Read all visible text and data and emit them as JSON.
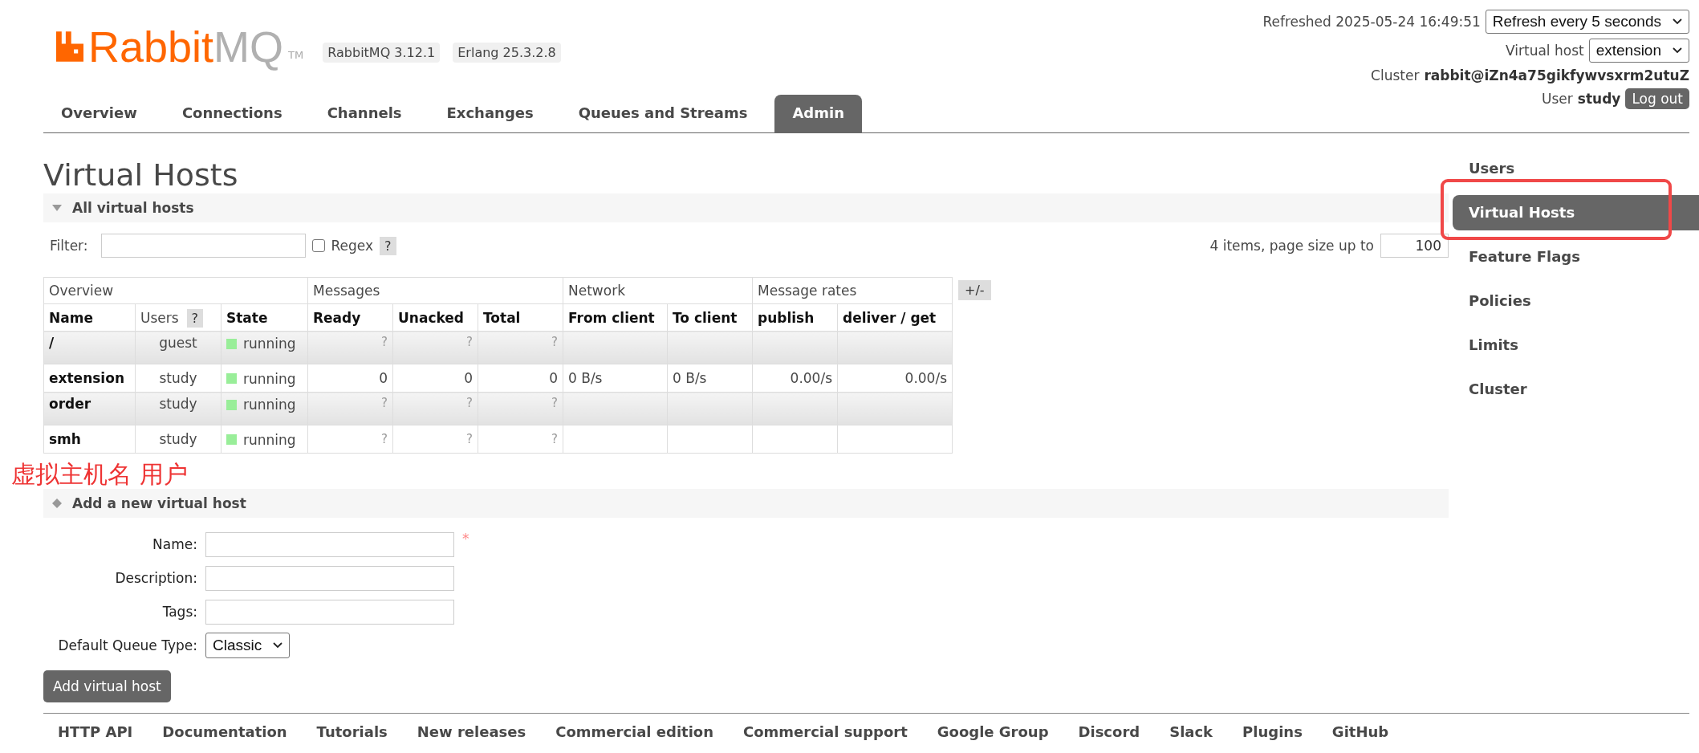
{
  "logo": {
    "brand": "Rabbit",
    "brand_suffix": "MQ",
    "trademark": "TM"
  },
  "version_badges": [
    "RabbitMQ 3.12.1",
    "Erlang 25.3.2.8"
  ],
  "header_status": {
    "refreshed": "Refreshed 2025-05-24 16:49:51",
    "refresh_select": "Refresh every 5 seconds",
    "vhost_label": "Virtual host",
    "vhost_select": "extension",
    "cluster_label": "Cluster",
    "cluster_name": "rabbit@iZn4a75gikfywvsxrm2utuZ",
    "user_label": "User",
    "user_name": "study",
    "logout": "Log out"
  },
  "tabs": [
    {
      "label": "Overview",
      "selected": false
    },
    {
      "label": "Connections",
      "selected": false
    },
    {
      "label": "Channels",
      "selected": false
    },
    {
      "label": "Exchanges",
      "selected": false
    },
    {
      "label": "Queues and Streams",
      "selected": false
    },
    {
      "label": "Admin",
      "selected": true
    }
  ],
  "page_title": "Virtual Hosts",
  "list_section": {
    "title": "All virtual hosts",
    "expanded": true
  },
  "filter": {
    "label": "Filter:",
    "regex_label": "Regex",
    "regex_checked": false,
    "help": "?",
    "items_info": "4 items, page size up to",
    "page_size": "100"
  },
  "table": {
    "toggle": "+/-",
    "groups": [
      {
        "label": "Overview"
      },
      {
        "label": "Messages"
      },
      {
        "label": "Network"
      },
      {
        "label": "Message rates"
      }
    ],
    "columns": [
      {
        "label": "Name"
      },
      {
        "label": "Users",
        "help": "?"
      },
      {
        "label": "State"
      },
      {
        "label": "Ready"
      },
      {
        "label": "Unacked"
      },
      {
        "label": "Total"
      },
      {
        "label": "From client"
      },
      {
        "label": "To client"
      },
      {
        "label": "publish"
      },
      {
        "label": "deliver / get"
      }
    ],
    "rows": [
      {
        "color": "#99ee99",
        "stats_available": false,
        "cells": [
          "/",
          "guest",
          "running",
          "?",
          "?",
          "?",
          "",
          "",
          "",
          ""
        ]
      },
      {
        "color": "#99ee99",
        "stats_available": true,
        "cells": [
          "extension",
          "study",
          "running",
          "0",
          "0",
          "0",
          "0 B/s",
          "0 B/s",
          "0.00/s",
          "0.00/s"
        ]
      },
      {
        "color": "#99ee99",
        "stats_available": false,
        "cells": [
          "order",
          "study",
          "running",
          "?",
          "?",
          "?",
          "",
          "",
          "",
          ""
        ]
      },
      {
        "color": "#99ee99",
        "stats_available": false,
        "cells": [
          "smh",
          "study",
          "running",
          "?",
          "?",
          "?",
          "",
          "",
          "",
          ""
        ]
      }
    ]
  },
  "annotation": {
    "note": "虚拟主机名  用户",
    "highlight_box": true
  },
  "add_section": {
    "title": "Add a new virtual host",
    "expanded": false,
    "fields": [
      {
        "kind": "text",
        "label": "Name:",
        "required_mark": "*"
      },
      {
        "kind": "text",
        "label": "Description:"
      },
      {
        "kind": "text",
        "label": "Tags:"
      },
      {
        "kind": "select",
        "label": "Default Queue Type:",
        "value": "Classic"
      }
    ],
    "submit": "Add virtual host"
  },
  "sidebar": {
    "items": [
      {
        "label": "Users",
        "selected": false
      },
      {
        "label": "Virtual Hosts",
        "selected": true
      },
      {
        "label": "Feature Flags",
        "selected": false
      },
      {
        "label": "Policies",
        "selected": false
      },
      {
        "label": "Limits",
        "selected": false
      },
      {
        "label": "Cluster",
        "selected": false
      }
    ]
  },
  "footer_links": [
    "HTTP API",
    "Documentation",
    "Tutorials",
    "New releases",
    "Commercial edition",
    "Commercial support",
    "Google Group",
    "Discord",
    "Slack",
    "Plugins",
    "GitHub"
  ]
}
